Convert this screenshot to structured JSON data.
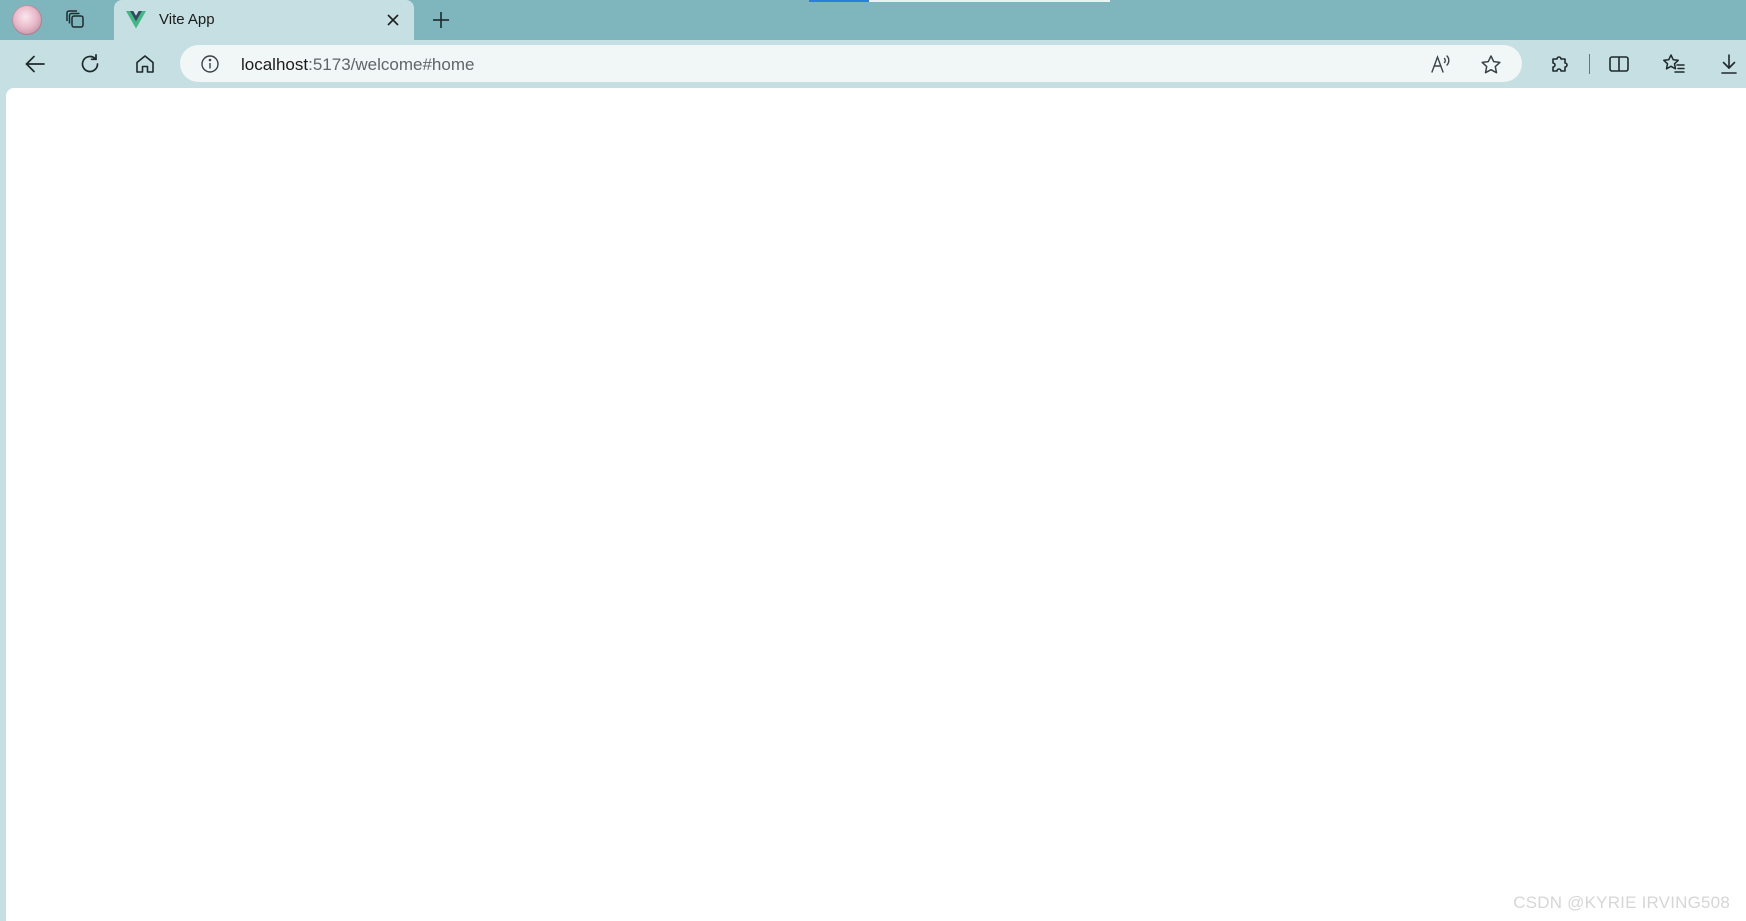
{
  "tab": {
    "title": "Vite App"
  },
  "address": {
    "host": "localhost",
    "path": ":5173/welcome#home"
  },
  "watermark": {
    "text": "CSDN @KYRIE IRVING508"
  },
  "icons": {
    "profile": "profile-avatar",
    "tab_actions": "tab-actions-icon",
    "favicon": "vue-logo-icon",
    "close": "close-icon",
    "new_tab": "plus-icon",
    "back": "back-arrow-icon",
    "refresh": "refresh-icon",
    "home": "home-icon",
    "info": "info-icon",
    "read_aloud": "read-aloud-icon",
    "favorite": "star-icon",
    "extensions": "puzzle-icon",
    "split_screen": "split-screen-icon",
    "favorites": "favorites-list-icon",
    "downloads": "download-icon"
  },
  "colors": {
    "tab_strip": "#7fb6be",
    "toolbar": "#c5dfe2",
    "address_bar": "#f1f6f7",
    "vue_green": "#41b883",
    "vue_dark": "#35495e"
  }
}
